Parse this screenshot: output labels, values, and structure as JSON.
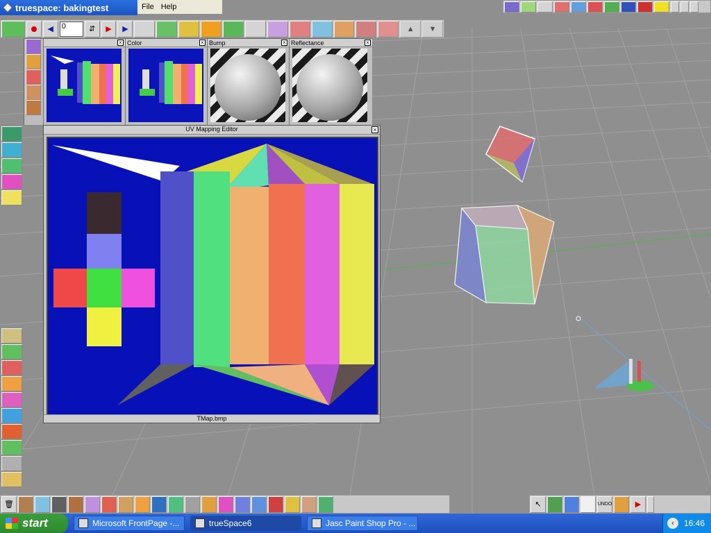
{
  "window": {
    "title": "truespace: bakingtest"
  },
  "menu": {
    "items": [
      "File",
      "Help"
    ]
  },
  "toolbar": {
    "frame_value": "0"
  },
  "materials": {
    "panels": [
      {
        "label": ""
      },
      {
        "label": "Color"
      },
      {
        "label": "Bump"
      },
      {
        "label": "Reflectance"
      }
    ]
  },
  "uv_editor": {
    "title": "UV Mapping Editor",
    "footer": "TMap.bmp"
  },
  "taskbar": {
    "start_label": "start",
    "tasks": [
      {
        "label": "Microsoft FrontPage -..."
      },
      {
        "label": "trueSpace6"
      },
      {
        "label": "Jasc Paint Shop Pro - ..."
      }
    ],
    "clock": "16:46"
  },
  "bottom_toolbar": {
    "undo_label": "UNDO"
  },
  "colors": {
    "uv_bg": "#0810b8",
    "taskbar": "#245edb",
    "start": "#3a9a3a"
  }
}
